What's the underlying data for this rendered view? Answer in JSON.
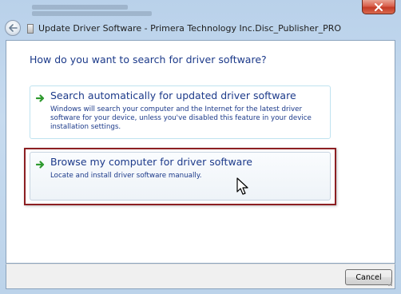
{
  "window": {
    "title": "Update Driver Software - Primera Technology Inc.Disc_Publisher_PRO",
    "close_icon": "close-icon",
    "back_icon": "back-arrow-icon"
  },
  "main": {
    "heading": "How do you want to search for driver software?",
    "options": [
      {
        "title": "Search automatically for updated driver software",
        "description": "Windows will search your computer and the Internet for the latest driver software for your device, unless you've disabled this feature in your device installation settings.",
        "icon": "green-arrow-icon"
      },
      {
        "title": "Browse my computer for driver software",
        "description": "Locate and install driver software manually.",
        "icon": "green-arrow-icon"
      }
    ]
  },
  "footer": {
    "cancel_label": "Cancel"
  },
  "colors": {
    "link_text": "#1c3a8a",
    "highlight_outline": "#8c1f22",
    "arrow_green": "#2f9a2f"
  }
}
